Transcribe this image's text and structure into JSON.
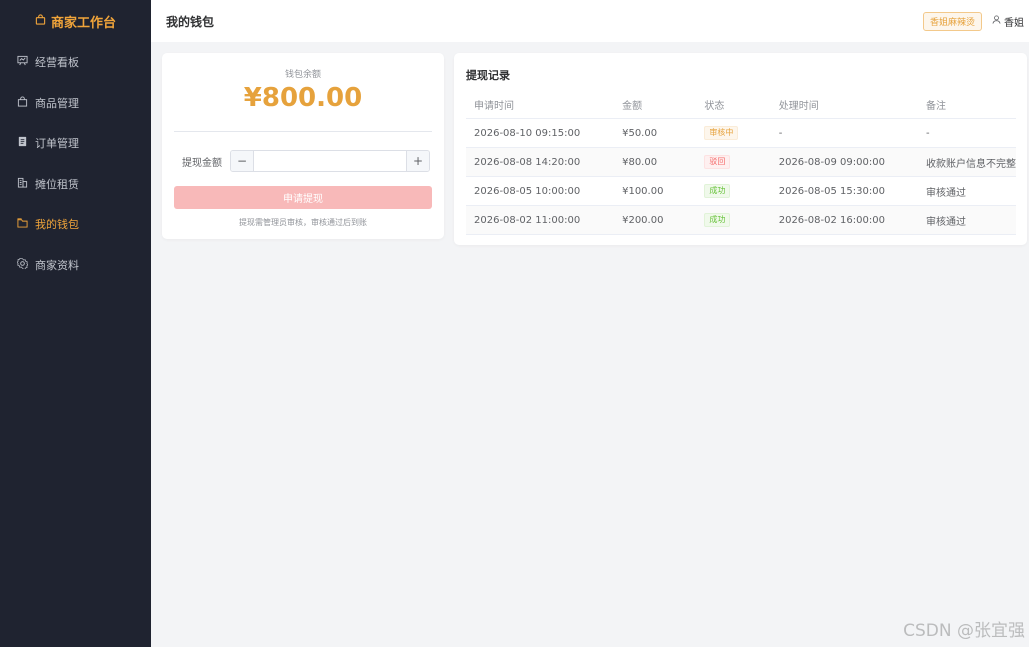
{
  "sidebar": {
    "brand": "商家工作台",
    "items": [
      {
        "label": "经营看板",
        "icon": "presentation-icon",
        "active": false
      },
      {
        "label": "商品管理",
        "icon": "bag-icon",
        "active": false
      },
      {
        "label": "订单管理",
        "icon": "document-icon",
        "active": false
      },
      {
        "label": "摊位租赁",
        "icon": "building-icon",
        "active": false
      },
      {
        "label": "我的钱包",
        "icon": "wallet-icon",
        "active": true
      },
      {
        "label": "商家资料",
        "icon": "settings-icon",
        "active": false
      }
    ]
  },
  "header": {
    "title": "我的钱包",
    "shop_tag": "香姐麻辣烫",
    "user_name": "香姐"
  },
  "wallet": {
    "balance_label": "钱包余额",
    "balance": "¥800.00",
    "amount_label": "提现金额",
    "amount_value": "",
    "minus": "−",
    "plus": "+",
    "apply_button": "申请提现",
    "hint": "提现需管理员审核，审核通过后到账"
  },
  "records": {
    "title": "提现记录",
    "columns": [
      "申请时间",
      "金额",
      "状态",
      "处理时间",
      "备注"
    ],
    "rows": [
      {
        "time": "2026-08-10 09:15:00",
        "amount": "¥50.00",
        "status": "审核中",
        "status_type": "pending",
        "processed": "-",
        "note": "-"
      },
      {
        "time": "2026-08-08 14:20:00",
        "amount": "¥80.00",
        "status": "驳回",
        "status_type": "rejected",
        "processed": "2026-08-09 09:00:00",
        "note": "收款账户信息不完整"
      },
      {
        "time": "2026-08-05 10:00:00",
        "amount": "¥100.00",
        "status": "成功",
        "status_type": "success",
        "processed": "2026-08-05 15:30:00",
        "note": "审核通过"
      },
      {
        "time": "2026-08-02 11:00:00",
        "amount": "¥200.00",
        "status": "成功",
        "status_type": "success",
        "processed": "2026-08-02 16:00:00",
        "note": "审核通过"
      }
    ]
  },
  "watermark": "CSDN @张宜强",
  "colors": {
    "accent": "#f0a43a",
    "sidebar_bg": "#1f2330",
    "balance": "#e6a23c",
    "apply_button_disabled": "#f8b9b9"
  }
}
